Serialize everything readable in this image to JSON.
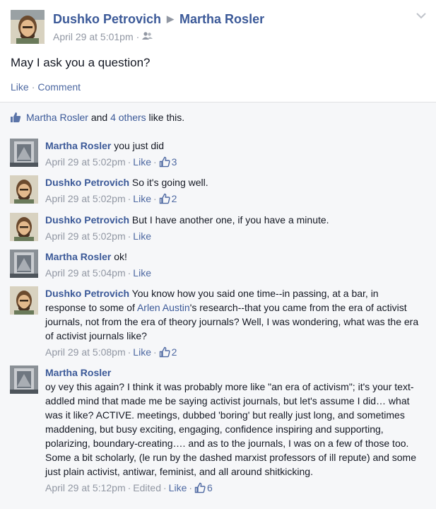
{
  "post": {
    "author": "Dushko Petrovich",
    "recipient": "Martha Rosler",
    "time": "April 29 at 5:01pm",
    "text": "May I ask you a question?",
    "like_label": "Like",
    "comment_label": "Comment"
  },
  "likes": {
    "name": "Martha Rosler",
    "and": "and",
    "others": "4 others",
    "suffix": "like this."
  },
  "comments": [
    {
      "author": "Martha Rosler",
      "text": "you just did",
      "time": "April 29 at 5:02pm",
      "like_label": "Like",
      "likes": "3"
    },
    {
      "author": "Dushko Petrovich",
      "text": "So it's going well.",
      "time": "April 29 at 5:02pm",
      "like_label": "Like",
      "likes": "2"
    },
    {
      "author": "Dushko Petrovich",
      "text": "But I have another one, if you have a minute.",
      "time": "April 29 at 5:02pm",
      "like_label": "Like"
    },
    {
      "author": "Martha Rosler",
      "text": "ok!",
      "time": "April 29 at 5:04pm",
      "like_label": "Like"
    },
    {
      "author": "Dushko Petrovich",
      "text_before": "You know how you said one time--in passing, at a bar, in response to some of ",
      "mention": "Arlen Austin",
      "text_after": "'s research--that you came from the era of activist journals, not from the era of theory journals? Well, I was wondering, what was the era of activist journals like?",
      "time": "April 29 at 5:08pm",
      "like_label": "Like",
      "likes": "2"
    },
    {
      "author": "Martha Rosler",
      "text": "oy vey this again? I think it was probably more like \"an era of activism\"; it's your text-addled mind that made me be saying activist journals, but let's assume I did… what was it like? ACTIVE. meetings, dubbed 'boring' but really just long, and sometimes maddening, but busy exciting, engaging, confidence inspiring and supporting, polarizing, boundary-creating…. and as to the journals, I was on a few of those too. Some a bit scholarly, (le run by the dashed marxist professors of ill repute) and some just plain activist, antiwar, feminist, and all around shitkicking.",
      "time": "April 29 at 5:12pm",
      "edited": "Edited",
      "like_label": "Like",
      "likes": "6"
    }
  ],
  "icons": [
    "friends-audience-icon",
    "chevron-down-icon",
    "thumbs-up-icon"
  ],
  "colors": {
    "link": "#3b5998",
    "meta": "#9197a3",
    "bg_comments": "#f6f7f9"
  }
}
